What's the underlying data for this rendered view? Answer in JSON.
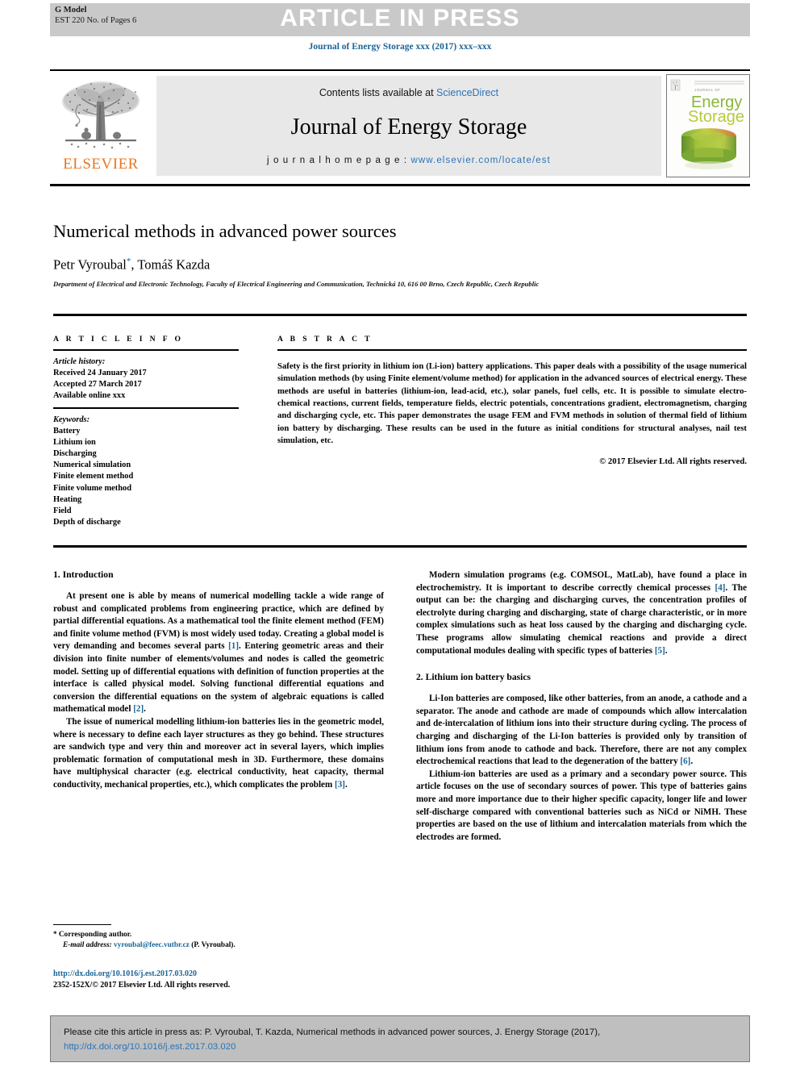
{
  "banner": {
    "g_model_line1": "G Model",
    "g_model_line2": "EST 220 No. of Pages 6",
    "article_in_press": "ARTICLE IN PRESS"
  },
  "running_head": "Journal of Energy Storage xxx (2017) xxx–xxx",
  "masthead": {
    "publisher": "ELSEVIER",
    "contents_prefix": "Contents lists available at ",
    "contents_link": "ScienceDirect",
    "journal_title": "Journal of Energy Storage",
    "homepage_prefix": "j o u r n a l  h o m e p a g e :  ",
    "homepage_url": "www.elsevier.com/locate/est",
    "cover": {
      "line1": "Energy",
      "line2": "Storage",
      "kicker": "JOURNAL OF"
    }
  },
  "article": {
    "title": "Numerical methods in advanced power sources",
    "authors": "Petr Vyroubal",
    "author_marker": "*",
    "authors_rest": ", Tomáš Kazda",
    "affiliation": "Department of Electrical and Electronic Technology, Faculty of Electrical Engineering and Communication, Technická 10, 616 00 Brno, Czech Republic, Czech Republic"
  },
  "article_info": {
    "heading": "A R T I C L E  I N F O",
    "history_label": "Article history:",
    "history": [
      "Received 24 January 2017",
      "Accepted 27 March 2017",
      "Available online xxx"
    ],
    "keywords_label": "Keywords:",
    "keywords": [
      "Battery",
      "Lithium ion",
      "Discharging",
      "Numerical simulation",
      "Finite element method",
      "Finite volume method",
      "Heating",
      "Field",
      "Depth of discharge"
    ]
  },
  "abstract": {
    "heading": "A B S T R A C T",
    "text": "Safety is the first priority in lithium ion (Li-ion) battery applications. This paper deals with a possibility of the usage numerical simulation methods (by using Finite element/volume method) for application in the advanced sources of electrical energy. These methods are useful in batteries (lithium-ion, lead-acid, etc.), solar panels, fuel cells, etc. It is possible to simulate electro-chemical reactions, current fields, temperature fields, electric potentials, concentrations gradient, electromagnetism, charging and discharging cycle, etc. This paper demonstrates the usage FEM and FVM methods in solution of thermal field of lithium ion battery by discharging. These results can be used in the future as initial conditions for structural analyses, nail test simulation, etc.",
    "copyright": "© 2017 Elsevier Ltd. All rights reserved."
  },
  "body": {
    "left": {
      "section1_heading": "1. Introduction",
      "p1_a": "At present one is able by means of numerical modelling tackle a wide range of robust and complicated problems from engineering practice, which are defined by partial differential equations. As a mathematical tool the finite element method (FEM) and finite volume method (FVM) is most widely used today. Creating a global model is very demanding and becomes several parts ",
      "p1_ref1": "[1]",
      "p1_b": ". Entering geometric areas and their division into finite number of elements/volumes and nodes is called the geometric model. Setting up of differential equations with definition of function properties at the interface is called physical model. Solving functional differential equations and conversion the differential equations on the system of algebraic equations is called mathematical model ",
      "p1_ref2": "[2]",
      "p1_c": ".",
      "p2_a": "The issue of numerical modelling lithium-ion batteries lies in the geometric model, where is necessary to define each layer structures as they go behind. These structures are sandwich type and very thin and moreover act in several layers, which implies problematic formation of computational mesh in 3D. Furthermore, these domains have multiphysical character (e.g. electrical conductivity, heat capacity, thermal conductivity, mechanical properties, etc.), which complicates the problem ",
      "p2_ref": "[3]",
      "p2_b": "."
    },
    "right": {
      "p1_a": "Modern simulation programs (e.g. COMSOL, MatLab), have found a place in electrochemistry. It is important to describe correctly chemical processes ",
      "p1_ref1": "[4]",
      "p1_b": ". The output can be: the charging and discharging curves, the concentration profiles of electrolyte during charging and discharging, state of charge characteristic, or in more complex simulations such as heat loss caused by the charging and discharging cycle. These programs allow simulating chemical reactions and provide a direct computational modules dealing with specific types of batteries ",
      "p1_ref2": "[5]",
      "p1_c": ".",
      "section2_heading": "2. Lithium ion battery basics",
      "p2_a": "Li-Ion batteries are composed, like other batteries, from an anode, a cathode and a separator. The anode and cathode are made of compounds which allow intercalation and de-intercalation of lithium ions into their structure during cycling. The process of charging and discharging of the Li-Ion batteries is provided only by transition of lithium ions from anode to cathode and back. Therefore, there are not any complex electrochemical reactions that lead to the degeneration of the battery ",
      "p2_ref": "[6]",
      "p2_b": ".",
      "p3": "Lithium-ion batteries are used as a primary and a secondary power source. This article focuses on the use of secondary sources of power. This type of batteries gains more and more importance due to their higher specific capacity, longer life and lower self-discharge compared with conventional batteries such as NiCd or NiMH. These properties are based on the use of lithium and intercalation materials from which the electrodes are formed."
    }
  },
  "footnote": {
    "marker": "*",
    "corresponding": "Corresponding author.",
    "email_label": "E-mail address:",
    "email": "vyroubal@feec.vutbr.cz",
    "email_suffix": "(P. Vyroubal)."
  },
  "doi_block": {
    "doi_url": "http://dx.doi.org/10.1016/j.est.2017.03.020",
    "issn_line": "2352-152X/© 2017 Elsevier Ltd. All rights reserved."
  },
  "citation_footer": {
    "text": "Please cite this article in press as: P. Vyroubal, T. Kazda, Numerical methods in advanced power sources, J. Energy Storage (2017), ",
    "link1": "http://dx.doi.",
    "link2": "org/10.1016/j.est.2017.03.020"
  },
  "colors": {
    "link_blue": "#2a73b8",
    "head_blue": "#1a6496",
    "elsevier_orange": "#E87722",
    "banner_gray": "#c9c9c9",
    "masthead_gray": "#e8e8e8",
    "footer_gray": "#bfbfbf"
  }
}
